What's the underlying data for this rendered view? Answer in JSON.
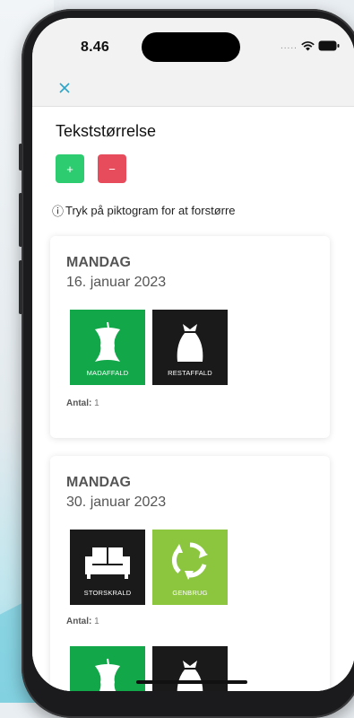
{
  "status": {
    "time": "8.46",
    "signal_dots": "....."
  },
  "title": "Tekststørrelse",
  "buttons": {
    "increase": "+",
    "decrease": "−"
  },
  "hint": {
    "icon": "ⓘ",
    "text": "Tryk på piktogram for at forstørre"
  },
  "colors": {
    "accent": "#2aa5c8",
    "increase": "#2ecc71",
    "decrease": "#e74c5c",
    "madaffald": "#12a84a",
    "restaffald": "#1a1a1a",
    "genbrug": "#8cc63f"
  },
  "days": [
    {
      "day": "MANDAG",
      "date": "16. januar 2023",
      "pictograms": [
        {
          "label": "MADAFFALD",
          "icon": "apple-core-icon"
        },
        {
          "label": "RESTAFFALD",
          "icon": "trash-bag-icon"
        }
      ],
      "count_label": "Antal:",
      "count_value": "1"
    },
    {
      "day": "MANDAG",
      "date": "30. januar 2023",
      "pictograms": [
        {
          "label": "STORSKRALD",
          "icon": "sofa-icon"
        },
        {
          "label": "GENBRUG",
          "icon": "recycle-icon"
        }
      ],
      "count_label": "Antal:",
      "count_value": "1"
    }
  ]
}
